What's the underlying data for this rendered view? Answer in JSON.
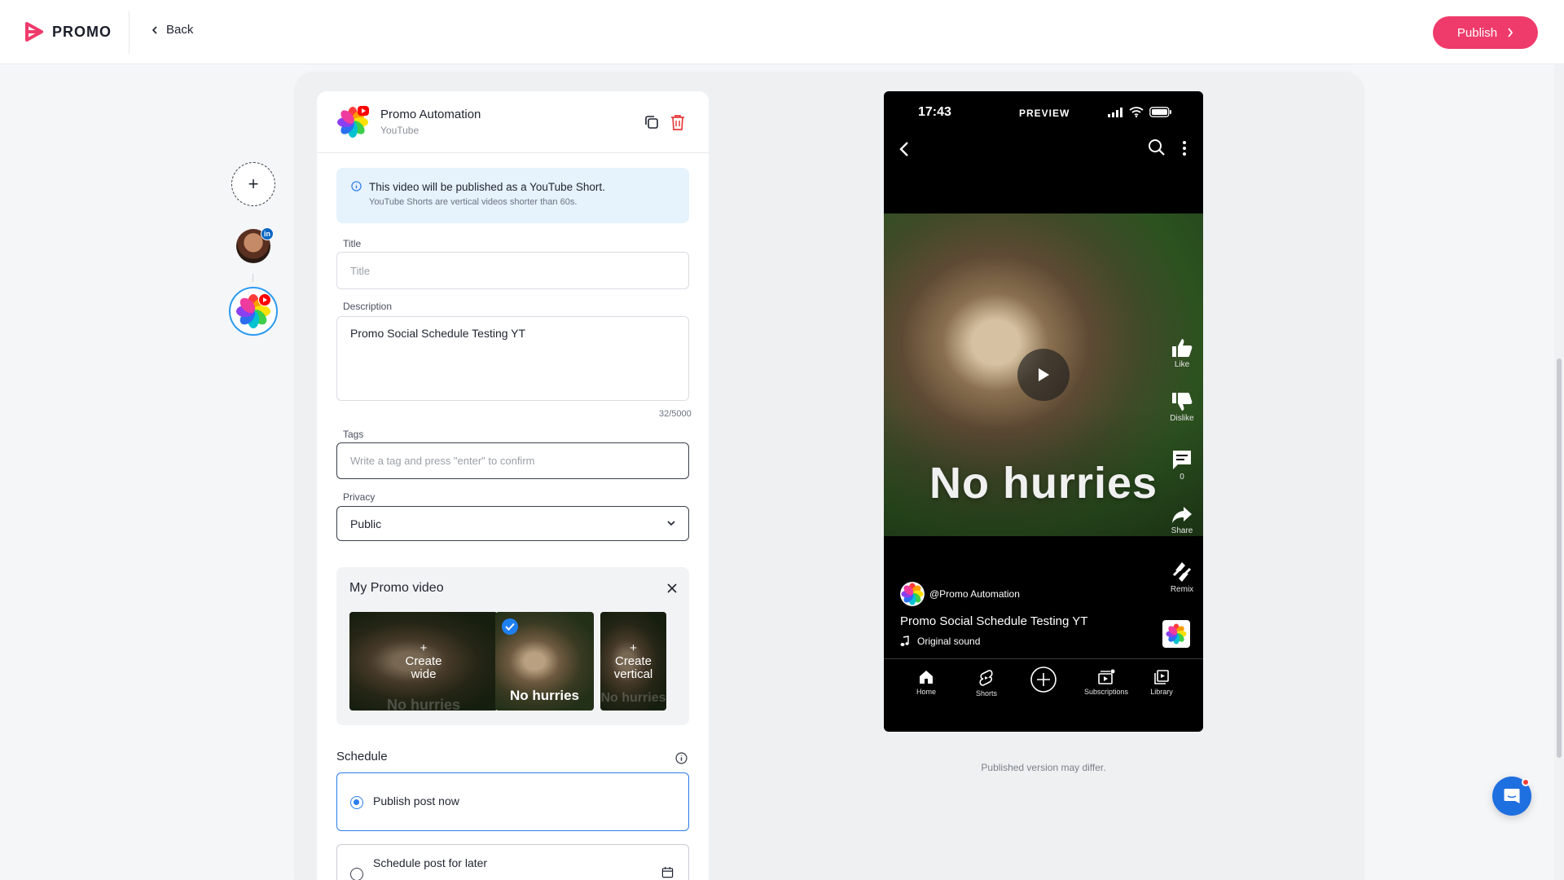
{
  "header": {
    "logo_text": "PROMO",
    "back_label": "Back",
    "publish_label": "Publish"
  },
  "profile": {
    "name": "Promo Automation",
    "platform": "YouTube"
  },
  "info": {
    "main": "This video will be published as a YouTube Short.",
    "sub": "YouTube Shorts are vertical videos shorter than 60s."
  },
  "form": {
    "title_label": "Title",
    "title_placeholder": "Title",
    "title_value": "",
    "description_label": "Description",
    "description_value": "Promo Social Schedule Testing YT",
    "char_count": "32/5000",
    "tags_label": "Tags",
    "tags_placeholder": "Write a tag and press \"enter\" to confirm",
    "privacy_label": "Privacy",
    "privacy_value": "Public"
  },
  "video": {
    "title": "My Promo video",
    "thumbs": [
      {
        "label_plus": "+",
        "label": "Create wide",
        "caption": "No hurries"
      },
      {
        "caption": "No hurries",
        "selected": true
      },
      {
        "label_plus": "+",
        "label": "Create vertical",
        "caption": "No hurries"
      }
    ]
  },
  "schedule": {
    "label": "Schedule",
    "options": [
      {
        "label": "Publish post now",
        "selected": true
      },
      {
        "label": "Schedule post for later",
        "selected": false
      }
    ]
  },
  "preview": {
    "time": "17:43",
    "header_label": "PREVIEW",
    "caption": "No hurries",
    "actions": {
      "like": "Like",
      "dislike": "Dislike",
      "comments": "0",
      "share": "Share",
      "remix": "Remix"
    },
    "channel": "@Promo Automation",
    "title": "Promo Social Schedule Testing YT",
    "sound": "Original sound",
    "nav": [
      "Home",
      "Shorts",
      "",
      "Subscriptions",
      "Library"
    ],
    "disclaimer": "Published version may differ."
  },
  "colors": {
    "accent": "#ef3b6b",
    "selection_blue": "#2b7de9",
    "info_bg": "#e6f2fc"
  }
}
